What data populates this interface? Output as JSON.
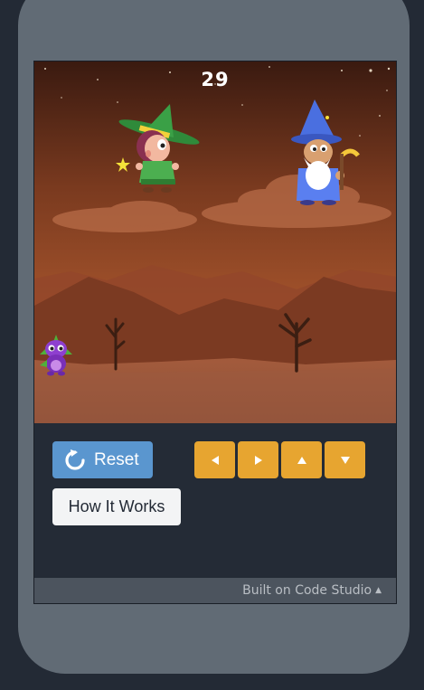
{
  "game": {
    "score": "29",
    "sprites": [
      "witch-sprite",
      "wizard-sprite",
      "purple-dragon-sprite"
    ]
  },
  "controls": {
    "reset_label": "Reset",
    "reset_icon": "refresh-icon",
    "how_label": "How It Works",
    "arrows": [
      "left-arrow-icon",
      "right-arrow-icon",
      "up-arrow-icon",
      "down-arrow-icon"
    ]
  },
  "footer": {
    "text": "Built on Code Studio",
    "caret": "▲"
  },
  "colors": {
    "reset_button": "#5a96cf",
    "arrow_button": "#e7a530",
    "phone_body": "#616b75",
    "page_bg": "#232a35"
  }
}
